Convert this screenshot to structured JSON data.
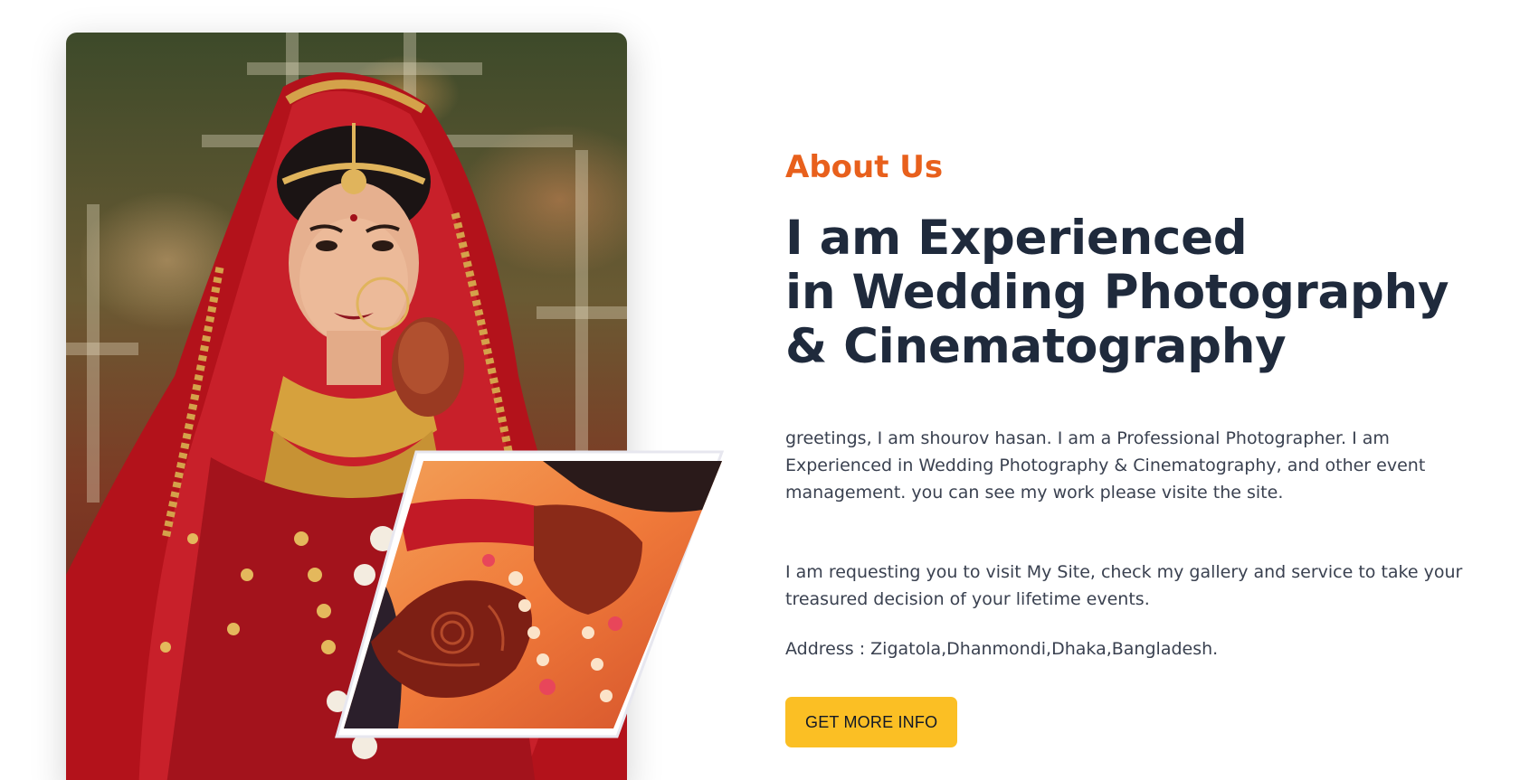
{
  "about": {
    "eyebrow": "About Us",
    "headline_lines": [
      "I am Experienced",
      "in Wedding Photography",
      "& Cinematography"
    ],
    "paragraph_1": "greetings, I am shourov hasan. I am a Professional Photographer. I am Experienced in Wedding Photography & Cinematography, and other event management. you can see my work please visite the site.",
    "paragraph_2": "I am requesting you to visit My Site, check my gallery and service to take your treasured decision of your lifetime events.",
    "address": "Address : Zigatola,Dhanmondi,Dhaka,Bangladesh.",
    "cta_label": "GET MORE INFO"
  },
  "images": {
    "main": "bride-portrait-image",
    "inset": "henna-hands-image"
  },
  "colors": {
    "eyebrow": "#e8601c",
    "headline": "#1f2a3c",
    "body": "#3a4150",
    "cta_background": "#fbbf24"
  }
}
